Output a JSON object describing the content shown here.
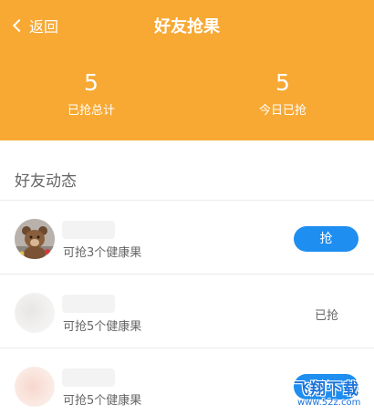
{
  "header": {
    "back_label": "返回",
    "title": "好友抢果",
    "background_color": "#f7a934"
  },
  "stats": [
    {
      "value": "5",
      "label": "已抢总计"
    },
    {
      "value": "5",
      "label": "今日已抢"
    }
  ],
  "section_title": "好友动态",
  "rows": [
    {
      "avatar": "teddy-bear-photo",
      "description": "可抢3个健康果",
      "action": "抢",
      "action_type": "button"
    },
    {
      "avatar": "blurred",
      "description": "可抢5个健康果",
      "action": "已抢",
      "action_type": "text"
    },
    {
      "avatar": "blurred",
      "description": "可抢5个健康果",
      "action": "抢",
      "action_type": "button"
    }
  ],
  "watermark": {
    "brand": "飞翔下载",
    "url": "www.52z.com"
  },
  "colors": {
    "accent_blue": "#1e8ef0",
    "text_gray": "#666666"
  }
}
